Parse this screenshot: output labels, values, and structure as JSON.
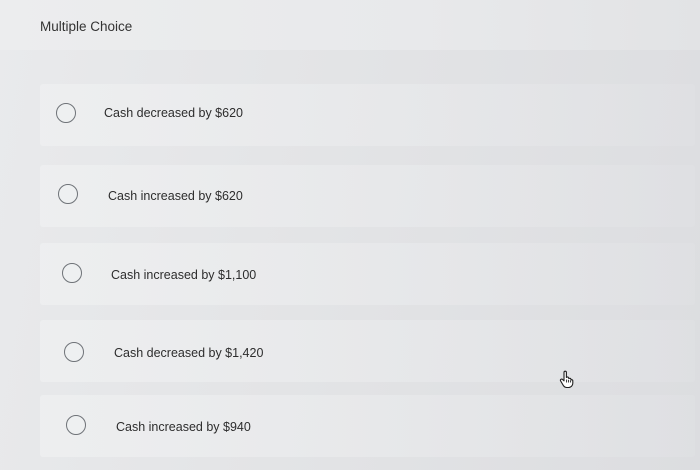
{
  "question": {
    "title": "Multiple Choice"
  },
  "options": [
    {
      "label": "Cash decreased by $620"
    },
    {
      "label": "Cash increased by $620"
    },
    {
      "label": "Cash increased by $1,100"
    },
    {
      "label": "Cash decreased by $1,420"
    },
    {
      "label": "Cash increased by $940"
    }
  ],
  "icons": {
    "radio": "radio-unselected-icon",
    "pointer": "hand-pointer-icon"
  }
}
